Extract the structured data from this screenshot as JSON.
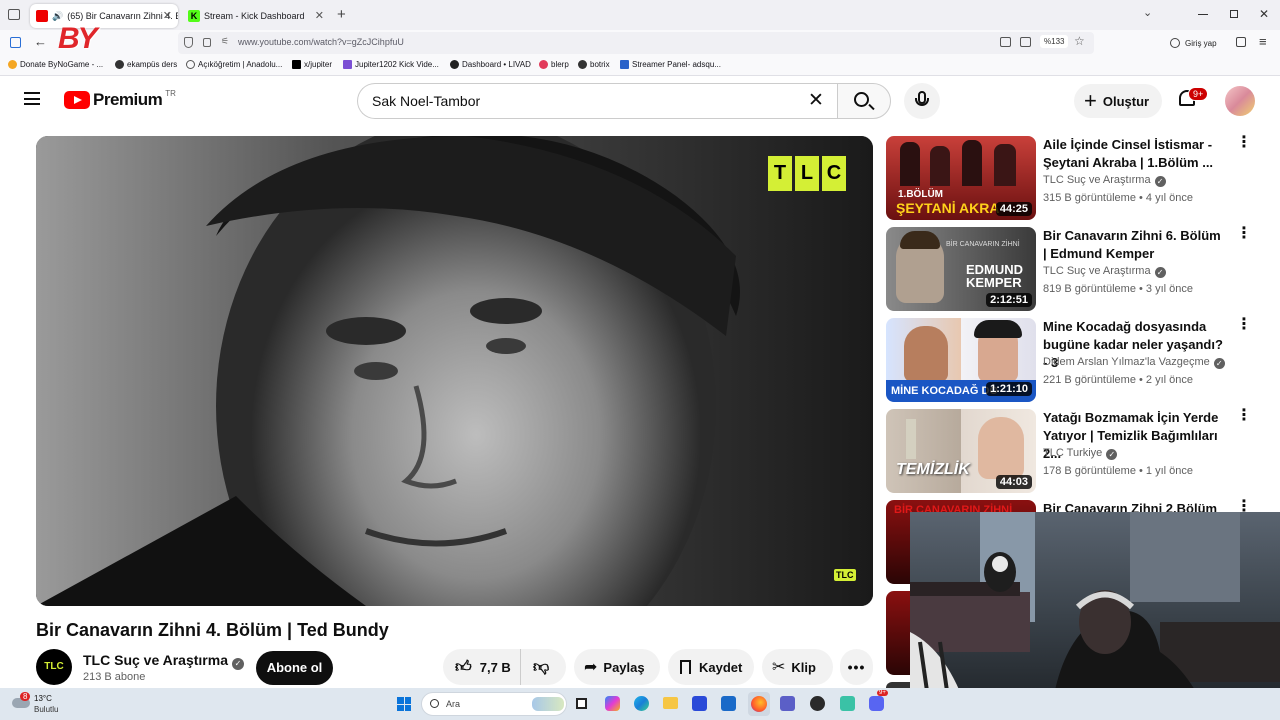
{
  "browser": {
    "tabs": [
      {
        "label": "(65) Bir Canavarın Zihni 4. B",
        "active": true
      },
      {
        "label": "Stream - Kick Dashboard",
        "active": false
      }
    ],
    "new_tab": "+",
    "url": "www.youtube.com/watch?v=gZcJCihpfuU",
    "zoom": "%133",
    "signin": "Giriş yap",
    "bookmarks": [
      "Donate ByNoGame - ...",
      "ekampüs ders",
      "Açıköğretim | Anadolu...",
      "x/jupiter",
      "Jupiter1202 Kick Vide...",
      "Dashboard • LIVAD",
      "blerp",
      "botrix",
      "Streamer Panel- adsqu..."
    ]
  },
  "youtube": {
    "logo": "Premium",
    "logo_region": "TR",
    "search_value": "Sak Noel-Tambor",
    "create_label": "Oluştur",
    "notif_badge": "9+",
    "video": {
      "title": "Bir Canavarın Zihni 4. Bölüm | Ted Bundy",
      "watermark": "TLC",
      "channel": "TLC Suç ve Araştırma",
      "subscribers": "213 B abone",
      "channel_avatar": "TLC",
      "subscribe_label": "Abone ol",
      "likes": "7,7 B",
      "share_label": "Paylaş",
      "save_label": "Kaydet",
      "clip_label": "Klip"
    },
    "recommendations": [
      {
        "title": "Aile İçinde Cinsel İstismar - Şeytani Akraba | 1.Bölüm ...",
        "channel": "TLC Suç ve Araştırma",
        "meta": "315 B görüntüleme • 4 yıl önce",
        "duration": "44:25",
        "thumb_text_top": "1.BÖLÜM",
        "thumb_text": "ŞEYTANİ AKRA",
        "colors": [
          "#7a1212",
          "#c23a2a"
        ]
      },
      {
        "title": "Bir Canavarın Zihni 6. Bölüm | Edmund Kemper",
        "channel": "TLC Suç ve Araştırma",
        "meta": "819 B görüntüleme • 3 yıl önce",
        "duration": "2:12:51",
        "thumb_text_top": "BİR CANAVARIN ZİHNİ",
        "thumb_text": "EDMUND KEMPER",
        "colors": [
          "#2b2b2b",
          "#6b6b6b"
        ]
      },
      {
        "title": "Mine Kocadağ dosyasında bugüne kadar neler yaşandı? - 3",
        "channel": "Didem Arslan Yılmaz'la Vazgeçme",
        "meta": "221 B görüntüleme • 2 yıl önce",
        "duration": "1:21:10",
        "thumb_text_top": "",
        "thumb_text": "MİNE KOCADAĞ DO",
        "colors": [
          "#c99a7a",
          "#e5e5f0"
        ]
      },
      {
        "title": "Yatağı Bozmamak İçin Yerde Yatıyor | Temizlik Bağımlıları 2...",
        "channel": "TLC Turkiye",
        "meta": "178 B görüntüleme • 1 yıl önce",
        "duration": "44:03",
        "thumb_text_top": "",
        "thumb_text": "TEMİZLİK",
        "colors": [
          "#b8a89a",
          "#d9cfc5"
        ]
      },
      {
        "title": "Bir Canavarın Zihni 2.Bölüm |",
        "channel": "",
        "meta": "",
        "duration": "",
        "thumb_text_top": "",
        "thumb_text": "BİR CANAVARIN ZİHNİ",
        "colors": [
          "#3a0a0a",
          "#8a1010"
        ]
      }
    ]
  },
  "taskbar": {
    "weather_temp": "13°C",
    "weather_desc": "Bulutlu",
    "weather_badge": "8",
    "search_placeholder": "Ara",
    "app_badge": "9+"
  },
  "overlay_logo": "BY"
}
